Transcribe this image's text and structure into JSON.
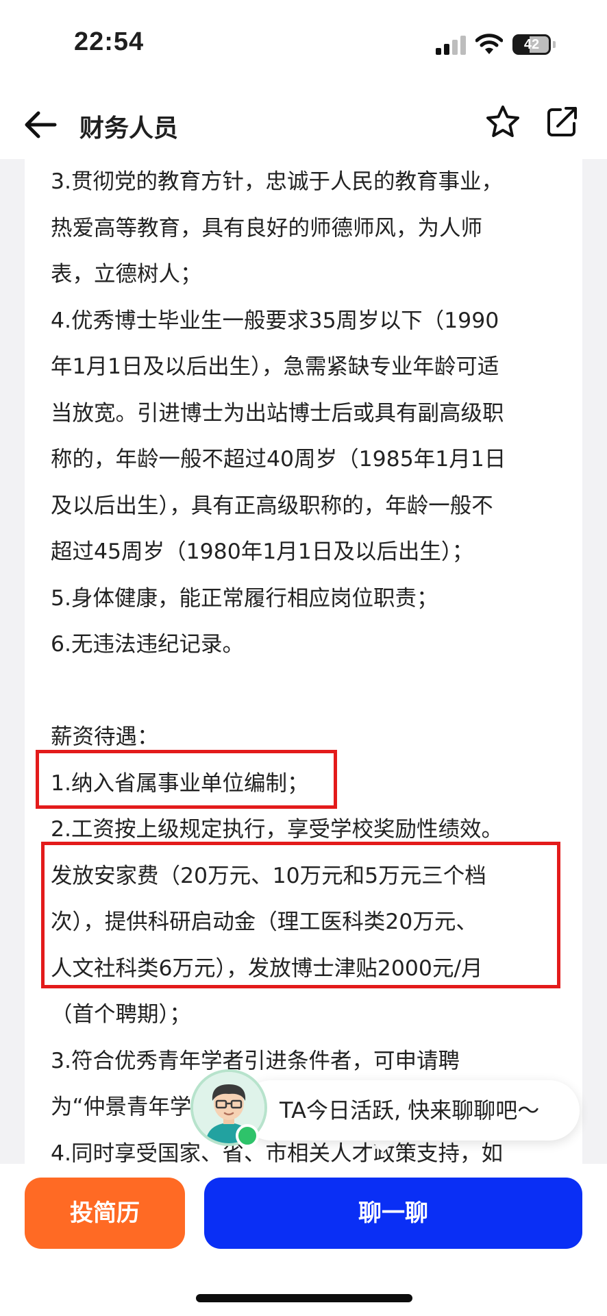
{
  "status_bar": {
    "time": "22:54",
    "battery": "42",
    "signal_icon": "cellular-signal-icon",
    "wifi_icon": "wifi-icon",
    "battery_icon": "battery-icon"
  },
  "nav": {
    "title": "财务人员",
    "back_icon": "arrow-left-icon",
    "favorite_icon": "star-icon",
    "share_icon": "share-icon"
  },
  "content": {
    "lines": [
      "3.贯彻党的教育方针，忠诚于人民的教育事业，",
      "热爱高等教育，具有良好的师德师风，为人师",
      "表，立德树人；",
      "4.优秀博士毕业生一般要求35周岁以下（1990",
      "年1月1日及以后出生），急需紧缺专业年龄可适",
      "当放宽。引进博士为出站博士后或具有副高级职",
      "称的，年龄一般不超过40周岁（1985年1月1日",
      "及以后出生），具有正高级职称的，年龄一般不",
      "超过45周岁（1980年1月1日及以后出生）；",
      "5.身体健康，能正常履行相应岗位职责；",
      "6.无违法违纪记录。",
      "",
      "薪资待遇：",
      "1.纳入省属事业单位编制；",
      "2.工资按上级规定执行，享受学校奖励性绩效。",
      "发放安家费（20万元、10万元和5万元三个档",
      "次），提供科研启动金（理工医科类20万元、",
      "人文社科类6万元），发放博士津贴2000元/月",
      "（首个聘期）；",
      "3.符合优秀青年学者引进条件者，可申请聘",
      "为“仲景青年学",
      "4.同时享受国家、省、市相关人才政策支持，如"
    ]
  },
  "highlight_color": "#e31b1b",
  "chat_prompt": {
    "text": "TA今日活跃, 快来聊聊吧～",
    "avatar_icon": "recruiter-avatar-icon",
    "status": "online"
  },
  "actions": {
    "resume_label": "投简历",
    "chat_label": "聊一聊",
    "resume_color": "#ff6a24",
    "chat_color": "#0a2ff5"
  }
}
